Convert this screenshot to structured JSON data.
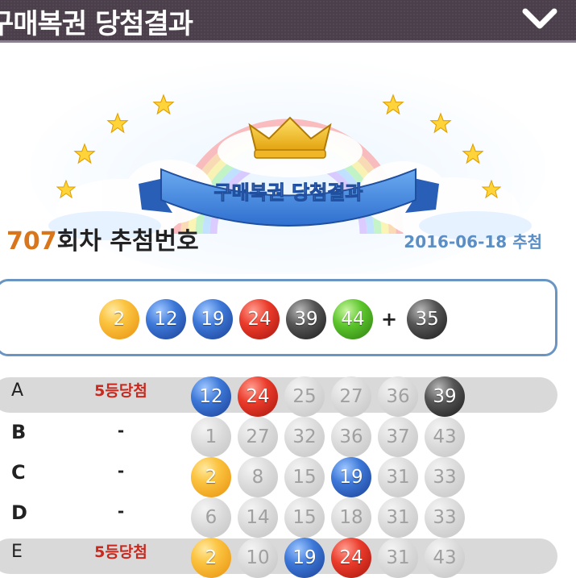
{
  "header": {
    "title": "구매복권 당첨결과",
    "collapse_icon": "chevron-down-icon"
  },
  "banner": {
    "ribbon_text": "구매복권 당첨결과",
    "icons": [
      "rainbow-icon",
      "crown-icon",
      "star-icon",
      "cloud-icon"
    ]
  },
  "draw": {
    "number": "707",
    "title_suffix": "회차 추첨번호",
    "date": "2016-06-18 추첨"
  },
  "winning": {
    "numbers": [
      {
        "value": "2",
        "color": "yellow"
      },
      {
        "value": "12",
        "color": "blue"
      },
      {
        "value": "19",
        "color": "blue"
      },
      {
        "value": "24",
        "color": "red"
      },
      {
        "value": "39",
        "color": "black"
      },
      {
        "value": "44",
        "color": "green"
      }
    ],
    "plus": "+",
    "bonus": {
      "value": "35",
      "color": "black"
    }
  },
  "tickets": [
    {
      "label": "A",
      "result": "5등당첨",
      "highlight": true,
      "numbers": [
        {
          "value": "12",
          "color": "blue"
        },
        {
          "value": "24",
          "color": "red"
        },
        {
          "value": "25",
          "color": "gray"
        },
        {
          "value": "27",
          "color": "gray"
        },
        {
          "value": "36",
          "color": "gray"
        },
        {
          "value": "39",
          "color": "black"
        }
      ]
    },
    {
      "label": "B",
      "result": "-",
      "highlight": false,
      "numbers": [
        {
          "value": "1",
          "color": "gray"
        },
        {
          "value": "27",
          "color": "gray"
        },
        {
          "value": "32",
          "color": "gray"
        },
        {
          "value": "36",
          "color": "gray"
        },
        {
          "value": "37",
          "color": "gray"
        },
        {
          "value": "43",
          "color": "gray"
        }
      ]
    },
    {
      "label": "C",
      "result": "-",
      "highlight": false,
      "numbers": [
        {
          "value": "2",
          "color": "yellow"
        },
        {
          "value": "8",
          "color": "gray"
        },
        {
          "value": "15",
          "color": "gray"
        },
        {
          "value": "19",
          "color": "blue"
        },
        {
          "value": "31",
          "color": "gray"
        },
        {
          "value": "33",
          "color": "gray"
        }
      ]
    },
    {
      "label": "D",
      "result": "-",
      "highlight": false,
      "numbers": [
        {
          "value": "6",
          "color": "gray"
        },
        {
          "value": "14",
          "color": "gray"
        },
        {
          "value": "15",
          "color": "gray"
        },
        {
          "value": "18",
          "color": "gray"
        },
        {
          "value": "31",
          "color": "gray"
        },
        {
          "value": "33",
          "color": "gray"
        }
      ]
    },
    {
      "label": "E",
      "result": "5등당첨",
      "highlight": true,
      "numbers": [
        {
          "value": "2",
          "color": "yellow"
        },
        {
          "value": "10",
          "color": "gray"
        },
        {
          "value": "19",
          "color": "blue"
        },
        {
          "value": "24",
          "color": "red"
        },
        {
          "value": "31",
          "color": "gray"
        },
        {
          "value": "43",
          "color": "gray"
        }
      ]
    }
  ],
  "colors": {
    "header_bg": "#4a3f4a",
    "accent_orange": "#d9751a",
    "date_blue": "#5a8ec5",
    "box_border": "#6a95c2",
    "win_red": "#c8281e"
  }
}
